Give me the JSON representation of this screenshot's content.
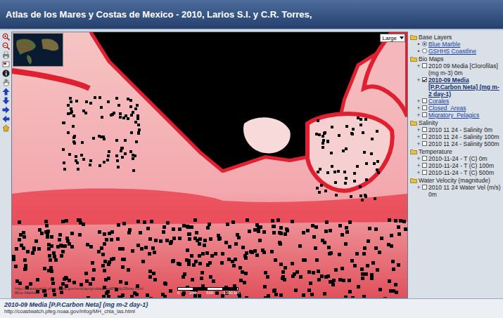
{
  "window": {
    "title": "Atlas de los Mares y Costas de Mexico - 2010, Larios S.I. y C.R. Torres,"
  },
  "map": {
    "size_select": "Large",
    "scale_labels": [
      "0",
      "250",
      "500",
      "1000 km"
    ],
    "credits": [
      "http://coastwatch.pfeg.noaa.gov/erddap/griddap/erdPPbfp28day.html",
      "Blue Marble"
    ]
  },
  "layers": [
    {
      "group": "Base Layers",
      "items": [
        {
          "kind": "radio",
          "expander": "•",
          "label": "Blue Marble",
          "selected": true
        },
        {
          "kind": "radio",
          "expander": "•",
          "label": "GSHHS Coastline",
          "selected": false
        }
      ]
    },
    {
      "group": "Bio Maps",
      "items": [
        {
          "kind": "checkbox",
          "expander": "+",
          "label": "2010 09 Media [Clorofilas] (mg m-3) 0m",
          "checked": false
        },
        {
          "kind": "checkbox",
          "expander": "+",
          "label": "2010-09 Media [P.P.Carbon Neta] (mg m-2 day-1)",
          "checked": true
        },
        {
          "kind": "checkbox",
          "expander": "+",
          "label": "Corales",
          "checked": false
        },
        {
          "kind": "checkbox",
          "expander": "+",
          "label": "Closed_Areas",
          "checked": false
        },
        {
          "kind": "checkbox",
          "expander": "+",
          "label": "Migratory_Pelagics",
          "checked": false
        }
      ]
    },
    {
      "group": "Salinity",
      "items": [
        {
          "kind": "checkbox",
          "expander": "+",
          "label": "2010 11 24 - Salinity 0m",
          "checked": false
        },
        {
          "kind": "checkbox",
          "expander": "+",
          "label": "2010 11 24 - Salinity 100m",
          "checked": false
        },
        {
          "kind": "checkbox",
          "expander": "+",
          "label": "2010 11 24 - Salinity 500m",
          "checked": false
        }
      ]
    },
    {
      "group": "Temperature",
      "items": [
        {
          "kind": "checkbox",
          "expander": "+",
          "label": "2010-11-24 - T (C) 0m",
          "checked": false
        },
        {
          "kind": "checkbox",
          "expander": "+",
          "label": "2010-11-24 - T (C) 100m",
          "checked": false
        },
        {
          "kind": "checkbox",
          "expander": "+",
          "label": "2010-11-24 - T (C) 500m",
          "checked": false
        }
      ]
    },
    {
      "group": "Water Velocity (magnitude)",
      "items": [
        {
          "kind": "checkbox",
          "expander": "+",
          "label": "2010 11 24 Water Vel (m/s) 0m",
          "checked": false
        }
      ]
    }
  ],
  "footer": {
    "title": "2010-09 Media [P.P.Carbon Neta] (mg m-2 day-1)",
    "url": "http://coastwatch.pfeg.noaa.gov/infog/MH_chla_las.html"
  }
}
